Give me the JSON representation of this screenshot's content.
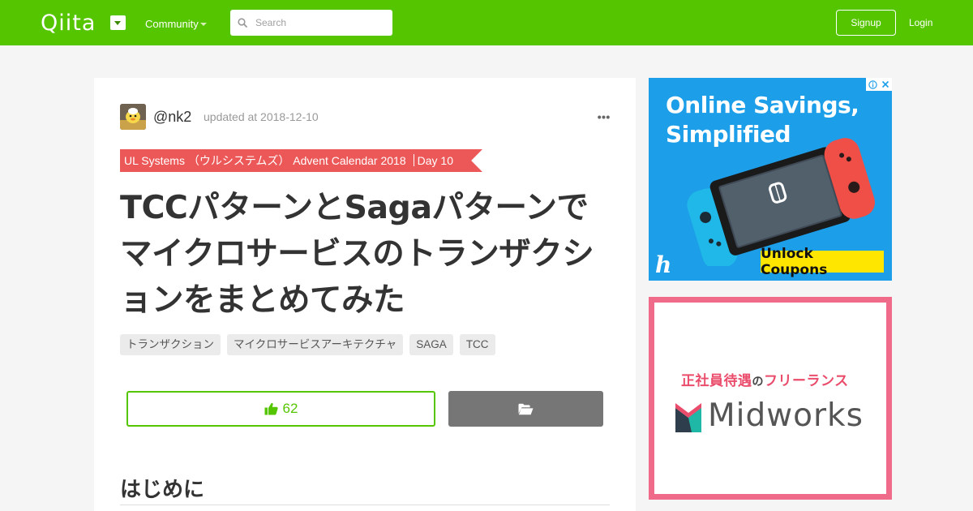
{
  "header": {
    "logo": "Qiita",
    "community_label": "Community",
    "search_placeholder": "Search",
    "signup_label": "Signup",
    "login_label": "Login"
  },
  "article": {
    "author": "@nk2",
    "updated": "updated at 2018-12-10",
    "calendar_name": "UL Systems （ウルシステムズ） Advent Calendar 2018",
    "calendar_day": "Day 10",
    "title": "TCCパターンとSagaパターンでマイクロサービスのトランザクションをまとめてみた",
    "tags": [
      "トランザクション",
      "マイクロサービスアーキテクチャ",
      "SAGA",
      "TCC"
    ],
    "likes": "62",
    "first_heading": "はじめに"
  },
  "ads": {
    "ad1": {
      "headline_line1": "Online Savings,",
      "headline_line2": "Simplified",
      "cta": "Unlock Coupons",
      "logo": "h"
    },
    "ad2": {
      "tagline_a": "正社員待遇",
      "tagline_b": "の",
      "tagline_c": "フリーランス",
      "brand": "Midworks"
    }
  },
  "colors": {
    "brand_green": "#55c500",
    "ribbon_red": "#ec5757",
    "ad1_blue": "#1d9ee9",
    "ad2_pink": "#f06b8a"
  },
  "icons": [
    "dropdown-icon",
    "search-icon",
    "more-icon",
    "thumbs-up-icon",
    "folder-open-icon",
    "ad-info-icon",
    "ad-close-icon"
  ]
}
